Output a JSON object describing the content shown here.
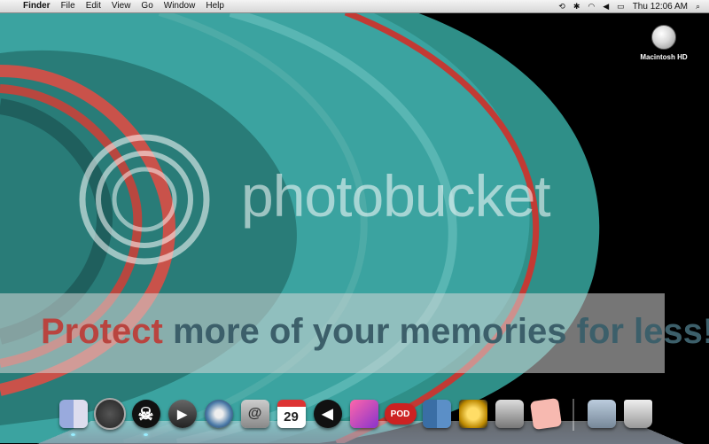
{
  "menubar": {
    "apple_icon": "apple-icon",
    "app_name": "Finder",
    "items": [
      "File",
      "Edit",
      "View",
      "Go",
      "Window",
      "Help"
    ],
    "status": {
      "icons": [
        "time-machine-icon",
        "bluetooth-icon",
        "wifi-icon",
        "volume-icon",
        "battery-icon"
      ],
      "clock": "Thu 12:06 AM",
      "spotlight_icon": "spotlight-search-icon"
    }
  },
  "desktop": {
    "hd_label": "Macintosh HD"
  },
  "watermark": {
    "brand": "photobucket",
    "banner_part1": "Protect ",
    "banner_part2": "more of your memories for less!"
  },
  "dock": {
    "items": [
      {
        "name": "finder-icon",
        "label": ""
      },
      {
        "name": "dashboard-icon",
        "label": ""
      },
      {
        "name": "skull-crossbones-icon",
        "label": "☠"
      },
      {
        "name": "video-chat-icon",
        "label": "▶"
      },
      {
        "name": "safari-icon",
        "label": ""
      },
      {
        "name": "address-book-icon",
        "label": "@"
      },
      {
        "name": "calendar-icon",
        "label": "29"
      },
      {
        "name": "speaker-icon",
        "label": "◀"
      },
      {
        "name": "iphoto-icon",
        "label": ""
      },
      {
        "name": "podcast-icon",
        "label": "POD"
      },
      {
        "name": "spaces-icon",
        "label": ""
      },
      {
        "name": "disc-icon",
        "label": ""
      },
      {
        "name": "system-preferences-icon",
        "label": ""
      },
      {
        "name": "sticky-note-icon",
        "label": ""
      },
      {
        "name": "downloads-stack-icon",
        "label": ""
      },
      {
        "name": "trash-icon",
        "label": ""
      }
    ]
  }
}
